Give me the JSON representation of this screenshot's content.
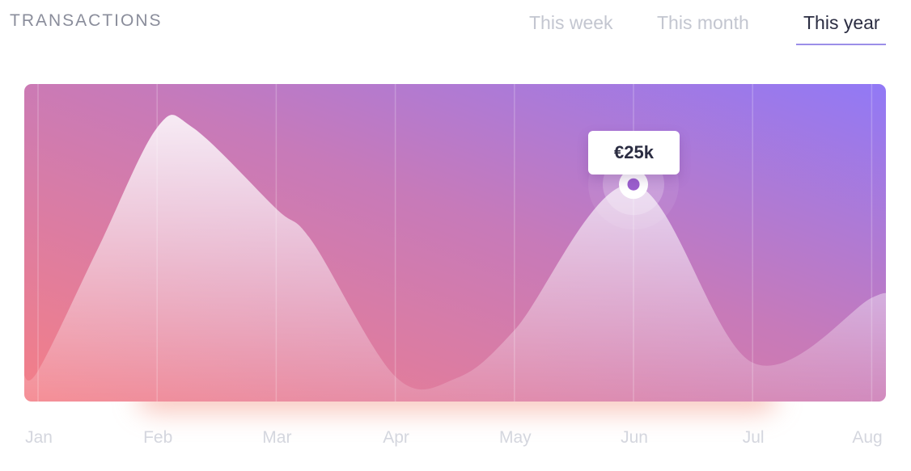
{
  "header": {
    "title": "TRANSACTIONS"
  },
  "tabs": [
    {
      "label": "This week",
      "active": false
    },
    {
      "label": "This month",
      "active": false
    },
    {
      "label": "This year",
      "active": true
    }
  ],
  "tooltip": {
    "value_label": "€25k"
  },
  "colors": {
    "gradient_start": "#f47f87",
    "gradient_mid": "#c77ab9",
    "gradient_end": "#9179f6",
    "accent": "#9b8ee8",
    "marker": "#9b5fce"
  },
  "chart_data": {
    "type": "area",
    "title": "TRANSACTIONS",
    "categories": [
      "Jan",
      "Feb",
      "Mar",
      "Apr",
      "May",
      "Jun",
      "Jul",
      "Aug"
    ],
    "series": [
      {
        "x": [
          0,
          0.5,
          1,
          1.3,
          2,
          2.3,
          3,
          3.5,
          4,
          5,
          6,
          7
        ],
        "values": [
          1,
          16,
          31,
          31,
          21,
          17,
          0.3,
          0,
          6,
          24,
          2,
          10
        ]
      }
    ],
    "highlight": {
      "category": "Jun",
      "label": "€25k"
    },
    "xlabel": "",
    "ylabel": "",
    "grid": true,
    "legend": "none"
  }
}
